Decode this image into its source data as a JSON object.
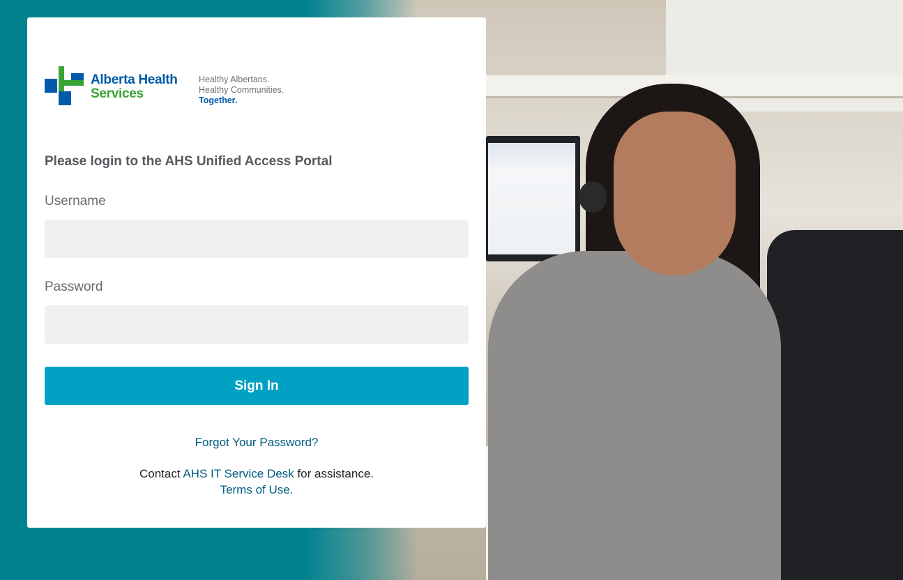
{
  "brand": {
    "name_line1": "Alberta Health",
    "name_line2": "Services",
    "tagline_1": "Healthy Albertans.",
    "tagline_2": "Healthy Communities.",
    "tagline_3": "Together.",
    "colors": {
      "blue": "#005aa9",
      "green": "#3aa335",
      "teal_background": "#01838f",
      "button": "#00a1c3",
      "link": "#005b7f"
    }
  },
  "login": {
    "heading": "Please login to the AHS Unified Access Portal",
    "username_label": "Username",
    "username_value": "",
    "password_label": "Password",
    "password_value": "",
    "signin_label": "Sign In",
    "forgot_label": "Forgot Your Password?",
    "contact_prefix": "Contact ",
    "contact_link": "AHS IT Service Desk",
    "contact_suffix": " for assistance.",
    "terms_link": "Terms of Use",
    "terms_suffix": "."
  },
  "background": {
    "photo_icon": "smiling-woman-with-headset-photo"
  }
}
